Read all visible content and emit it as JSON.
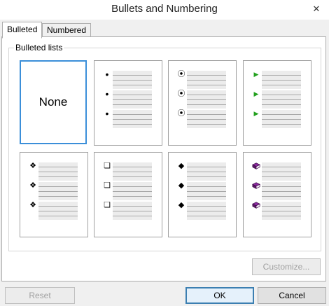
{
  "window": {
    "title": "Bullets and Numbering",
    "close_glyph": "✕"
  },
  "tabs": [
    {
      "label": "Bulleted",
      "active": true
    },
    {
      "label": "Numbered",
      "active": false
    }
  ],
  "group": {
    "label": "Bulleted lists"
  },
  "options": [
    {
      "name": "none",
      "text": "None",
      "selected": true
    },
    {
      "name": "small-dot",
      "icon": "small-dot-icon",
      "glyph": "•",
      "color": "#000000"
    },
    {
      "name": "circle-dot",
      "icon": "circle-dot-icon",
      "glyph": "⦿",
      "color": "#000000"
    },
    {
      "name": "green-arrow",
      "icon": "green-arrow-icon",
      "glyph": "▶",
      "color": "#22a01e"
    },
    {
      "name": "four-diamonds",
      "icon": "four-diamonds-icon",
      "glyph": "❖",
      "color": "#000000"
    },
    {
      "name": "hollow-square",
      "icon": "hollow-square-icon",
      "glyph": "❏",
      "color": "#000000"
    },
    {
      "name": "small-diamond",
      "icon": "small-diamond-icon",
      "glyph": "◆",
      "color": "#000000"
    },
    {
      "name": "purple-book",
      "icon": "purple-book-icon",
      "glyph": "",
      "color": "#8a2a9e"
    }
  ],
  "buttons": {
    "customize": "Customize...",
    "reset": "Reset",
    "ok": "OK",
    "cancel": "Cancel"
  }
}
